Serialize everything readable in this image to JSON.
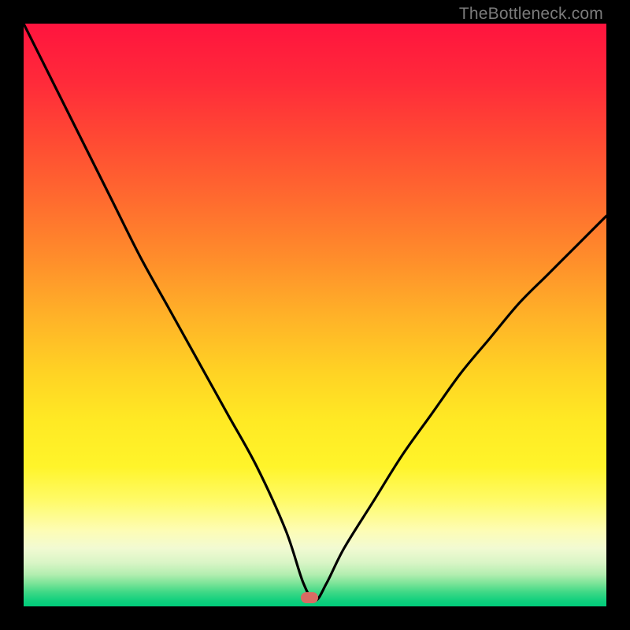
{
  "watermark": "TheBottleneck.com",
  "chart_data": {
    "type": "line",
    "title": "",
    "xlabel": "",
    "ylabel": "",
    "xlim": [
      0,
      100
    ],
    "ylim": [
      0,
      100
    ],
    "grid": false,
    "legend": false,
    "series": [
      {
        "name": "bottleneck-curve",
        "color": "#000000",
        "x": [
          0,
          5,
          10,
          15,
          20,
          25,
          30,
          35,
          40,
          45,
          48,
          50,
          52,
          55,
          60,
          65,
          70,
          75,
          80,
          85,
          90,
          95,
          100
        ],
        "values": [
          100,
          90,
          80,
          70,
          60,
          51,
          42,
          33,
          24,
          13,
          4,
          1,
          4,
          10,
          18,
          26,
          33,
          40,
          46,
          52,
          57,
          62,
          67
        ]
      }
    ],
    "marker": {
      "x": 49,
      "y": 1.5,
      "color": "#d96b63"
    },
    "background_gradient": {
      "stops": [
        {
          "offset": 0.0,
          "color": "#ff143e"
        },
        {
          "offset": 0.1,
          "color": "#ff2a3a"
        },
        {
          "offset": 0.2,
          "color": "#ff4a33"
        },
        {
          "offset": 0.3,
          "color": "#ff6a2f"
        },
        {
          "offset": 0.4,
          "color": "#ff8c2b"
        },
        {
          "offset": 0.5,
          "color": "#ffb128"
        },
        {
          "offset": 0.6,
          "color": "#ffd324"
        },
        {
          "offset": 0.68,
          "color": "#ffe924"
        },
        {
          "offset": 0.76,
          "color": "#fff42a"
        },
        {
          "offset": 0.82,
          "color": "#fffb6a"
        },
        {
          "offset": 0.87,
          "color": "#fdfdb5"
        },
        {
          "offset": 0.9,
          "color": "#f2fad2"
        },
        {
          "offset": 0.925,
          "color": "#d9f5c6"
        },
        {
          "offset": 0.945,
          "color": "#b3eeb0"
        },
        {
          "offset": 0.96,
          "color": "#7ee499"
        },
        {
          "offset": 0.975,
          "color": "#41d987"
        },
        {
          "offset": 0.99,
          "color": "#11d07d"
        },
        {
          "offset": 1.0,
          "color": "#00cc7a"
        }
      ]
    }
  }
}
